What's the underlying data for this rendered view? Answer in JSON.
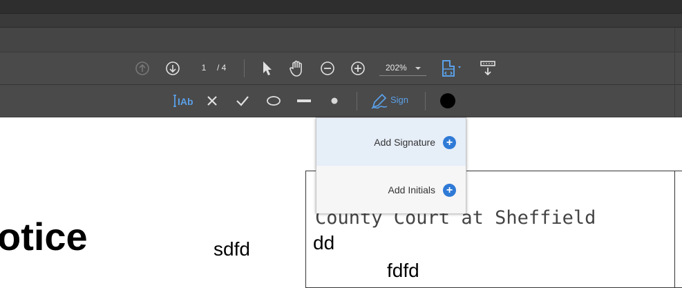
{
  "toolbar": {
    "page_current": "1",
    "page_total": "/ 4",
    "zoom": "202%",
    "sign_label": "Sign",
    "text_tool_label": "IAb"
  },
  "sign_menu": {
    "items": [
      {
        "label": "Add Signature",
        "icon": "plus-circle-icon"
      },
      {
        "label": "Add Initials",
        "icon": "plus-circle-icon"
      }
    ],
    "plus_glyph": "+"
  },
  "document": {
    "heading_fragment": "otice",
    "text_sdfd": "sdfd",
    "court_line": "County Court at Sheffield",
    "text_dd": "dd",
    "text_fdfd": "fdfd"
  },
  "colors": {
    "accent": "#5aa0e8",
    "toolbar_bg": "#4a4a4a",
    "menu_highlight": "#e6eef8",
    "plus_button": "#2f7ad6",
    "signature_color": "#000000"
  }
}
